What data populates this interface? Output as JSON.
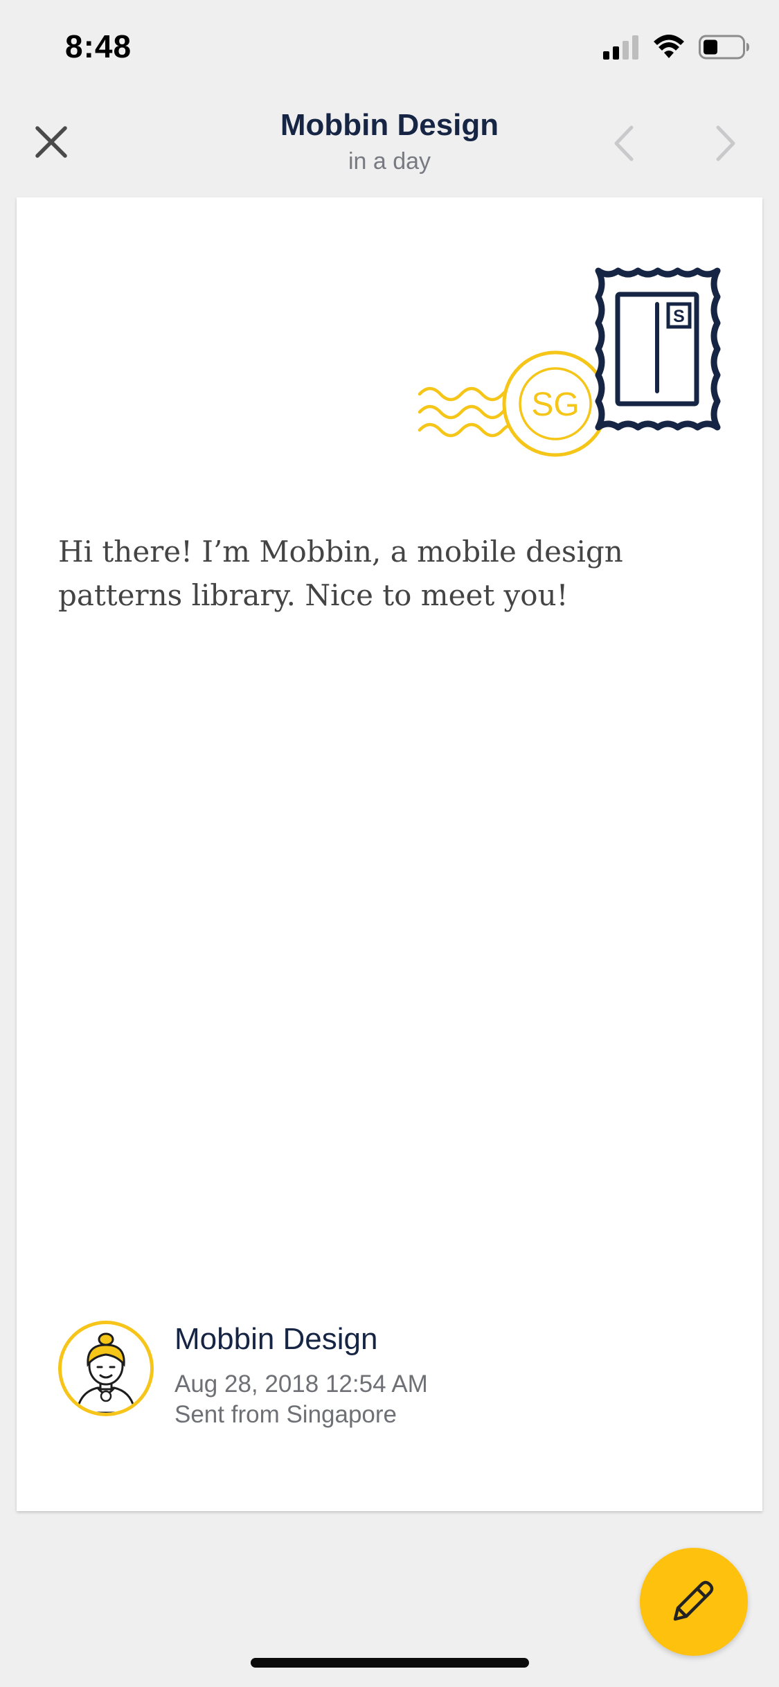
{
  "status_bar": {
    "time": "8:48",
    "icons": [
      "cellular-signal-icon",
      "wifi-icon",
      "battery-icon"
    ]
  },
  "nav": {
    "title": "Mobbin Design",
    "subtitle": "in a day",
    "close_icon": "close-icon",
    "prev_icon": "chevron-left-icon",
    "next_icon": "chevron-right-icon"
  },
  "letter": {
    "stamp": {
      "postmark_text": "SG",
      "stamp_letter": "S"
    },
    "message": "Hi there! I’m Mobbin, a mobile design patterns library. Nice to meet you!",
    "sender": {
      "name": "Mobbin Design",
      "date": "Aug 28, 2018 12:54 AM",
      "location": "Sent from Singapore",
      "avatar_icon": "avatar-icon"
    }
  },
  "fab": {
    "icon": "pencil-icon"
  },
  "colors": {
    "background": "#efeff0",
    "navy": "#172544",
    "accent_yellow": "#fec10d",
    "postmark_yellow": "#f5c518",
    "muted_text": "#6e7075"
  }
}
